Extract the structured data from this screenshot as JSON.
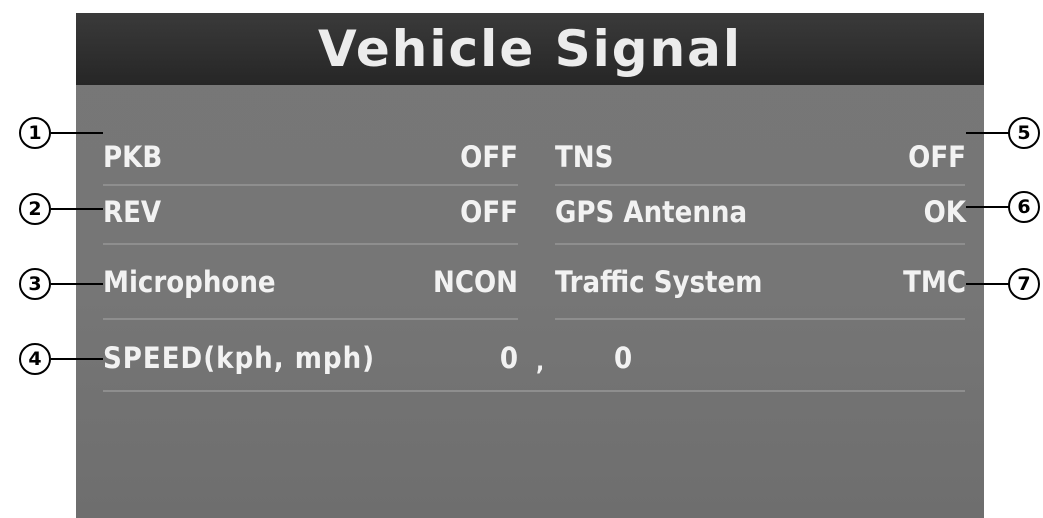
{
  "title": "Vehicle Signal",
  "rows": [
    {
      "left": {
        "label": "PKB",
        "value": "OFF"
      },
      "right": {
        "label": "TNS",
        "value": "OFF"
      }
    },
    {
      "left": {
        "label": "REV",
        "value": "OFF"
      },
      "right": {
        "label": "GPS Antenna",
        "value": "OK"
      }
    },
    {
      "left": {
        "label": "Microphone",
        "value": "NCON"
      },
      "right": {
        "label": "Traffic System",
        "value": "TMC"
      }
    }
  ],
  "speed": {
    "label": "SPEED(kph, mph)",
    "kph": "0",
    "separator": ",",
    "mph": "0"
  },
  "callouts": [
    "1",
    "2",
    "3",
    "4",
    "5",
    "6",
    "7"
  ],
  "colors": {
    "title_bar": "#2e2e2e",
    "panel": "#777777",
    "text": "#f2f2f2"
  }
}
